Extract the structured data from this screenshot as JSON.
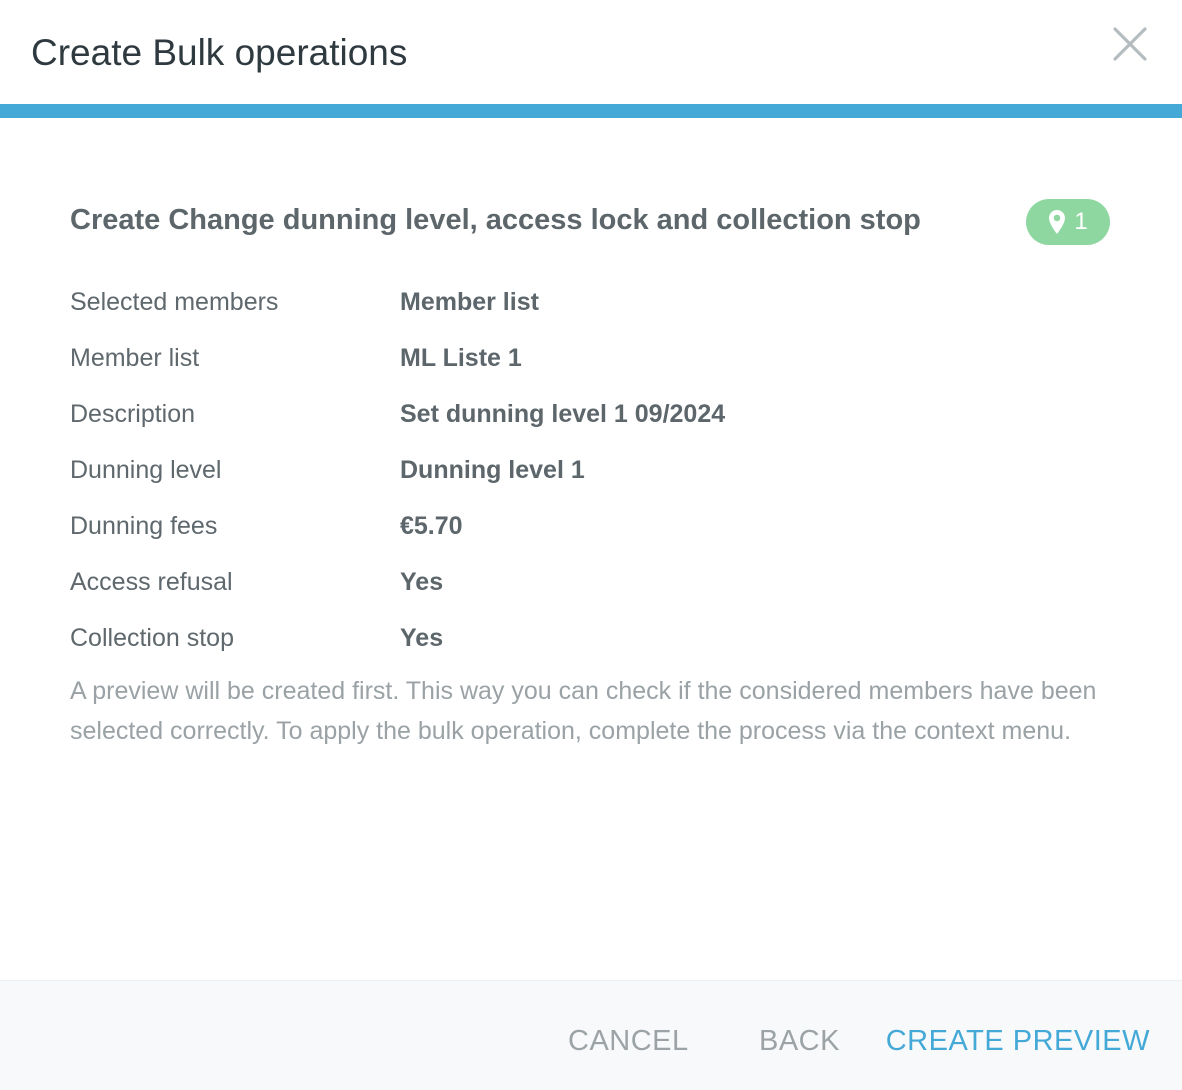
{
  "dialog": {
    "title": "Create Bulk operations",
    "accent_color": "#45a9d8"
  },
  "section": {
    "title": "Create Change dunning level, access lock and collection stop",
    "badge": {
      "icon": "map-marker-icon",
      "count": "1",
      "color": "#8fd7a1"
    }
  },
  "details": [
    {
      "label": "Selected members",
      "value": "Member list"
    },
    {
      "label": "Member list",
      "value": "ML Liste 1"
    },
    {
      "label": "Description",
      "value": "Set dunning level 1 09/2024"
    },
    {
      "label": "Dunning level",
      "value": "Dunning level 1"
    },
    {
      "label": "Dunning fees",
      "value": "€5.70"
    },
    {
      "label": "Access refusal",
      "value": "Yes"
    },
    {
      "label": "Collection stop",
      "value": "Yes"
    }
  ],
  "info_text": "A preview will be created first. This way you can check if the considered members have been selected correctly. To apply the bulk operation, complete the process via the context menu.",
  "footer": {
    "cancel_label": "CANCEL",
    "back_label": "BACK",
    "create_label": "CREATE PREVIEW",
    "primary_color": "#45a9d8"
  }
}
